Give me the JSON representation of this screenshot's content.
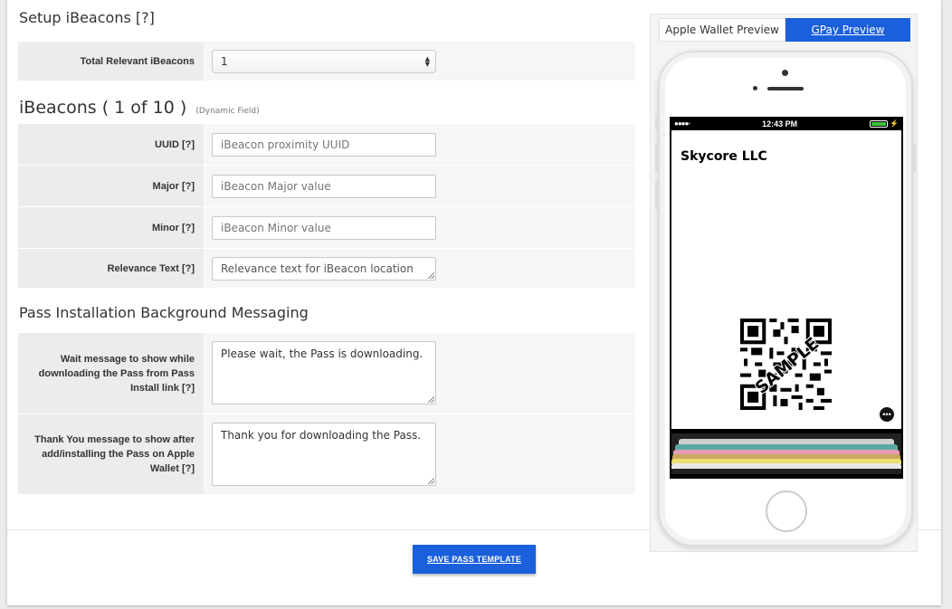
{
  "setup": {
    "heading": "Setup iBeacons [?]",
    "total_label": "Total Relevant iBeacons",
    "total_value": "1"
  },
  "ibeacons": {
    "heading": "iBeacons ( 1 of 10 )",
    "dynamic_note": "(Dynamic Field)",
    "fields": [
      {
        "label": "UUID",
        "help": "[?]",
        "placeholder": "iBeacon proximity UUID"
      },
      {
        "label": "Major",
        "help": "[?]",
        "placeholder": "iBeacon Major value"
      },
      {
        "label": "Minor",
        "help": "[?]",
        "placeholder": "iBeacon Minor value"
      },
      {
        "label": "Relevance Text",
        "help": "[?]",
        "placeholder": "Relevance text for iBeacon location"
      }
    ]
  },
  "messaging": {
    "heading": "Pass Installation Background Messaging",
    "wait_label": "Wait message to show while downloading the Pass from Pass Install link",
    "wait_help": "[?]",
    "wait_value": "Please wait, the Pass is downloading.",
    "thanks_label": "Thank You message to show after add/installing the Pass on Apple Wallet",
    "thanks_help": "[?]",
    "thanks_value": "Thank you for downloading the Pass."
  },
  "actions": {
    "save_label": "SAVE PASS TEMPLATE"
  },
  "preview": {
    "tab_apple": "Apple Wallet Preview",
    "tab_gpay": "GPay Preview",
    "active_tab": "GPay Preview",
    "status_signal": "●●●●◦",
    "status_time": "12:43 PM",
    "pass_title": "Skycore LLC",
    "qr_watermark": "SAMPLE",
    "more_icon": "ellipsis-icon"
  },
  "colors": {
    "accent": "#1a5fdc",
    "battery": "#3ac23a"
  }
}
